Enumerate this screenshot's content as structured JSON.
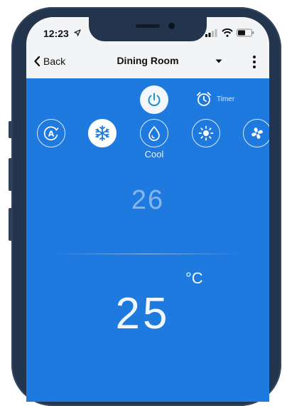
{
  "status_bar": {
    "time": "12:23"
  },
  "nav": {
    "back_label": "Back",
    "title": "Dining Room"
  },
  "controls": {
    "power_icon": "power-icon",
    "timer_label": "Timer"
  },
  "modes": {
    "items": [
      {
        "name": "auto",
        "icon": "auto-mode-icon"
      },
      {
        "name": "snowflake",
        "icon": "snowflake-icon",
        "active": true
      },
      {
        "name": "dry",
        "icon": "droplet-icon"
      },
      {
        "name": "heat",
        "icon": "sun-icon"
      },
      {
        "name": "fan",
        "icon": "fan-icon"
      }
    ],
    "selected_label": "Cool"
  },
  "temperature": {
    "set_point": "26",
    "current": "25",
    "unit": "°C"
  },
  "colors": {
    "main_blue": "#1f7ae0",
    "phone_frame": "#23344d",
    "nav_bg": "#f3f4f6",
    "power_icon": "#1f8fbf"
  }
}
